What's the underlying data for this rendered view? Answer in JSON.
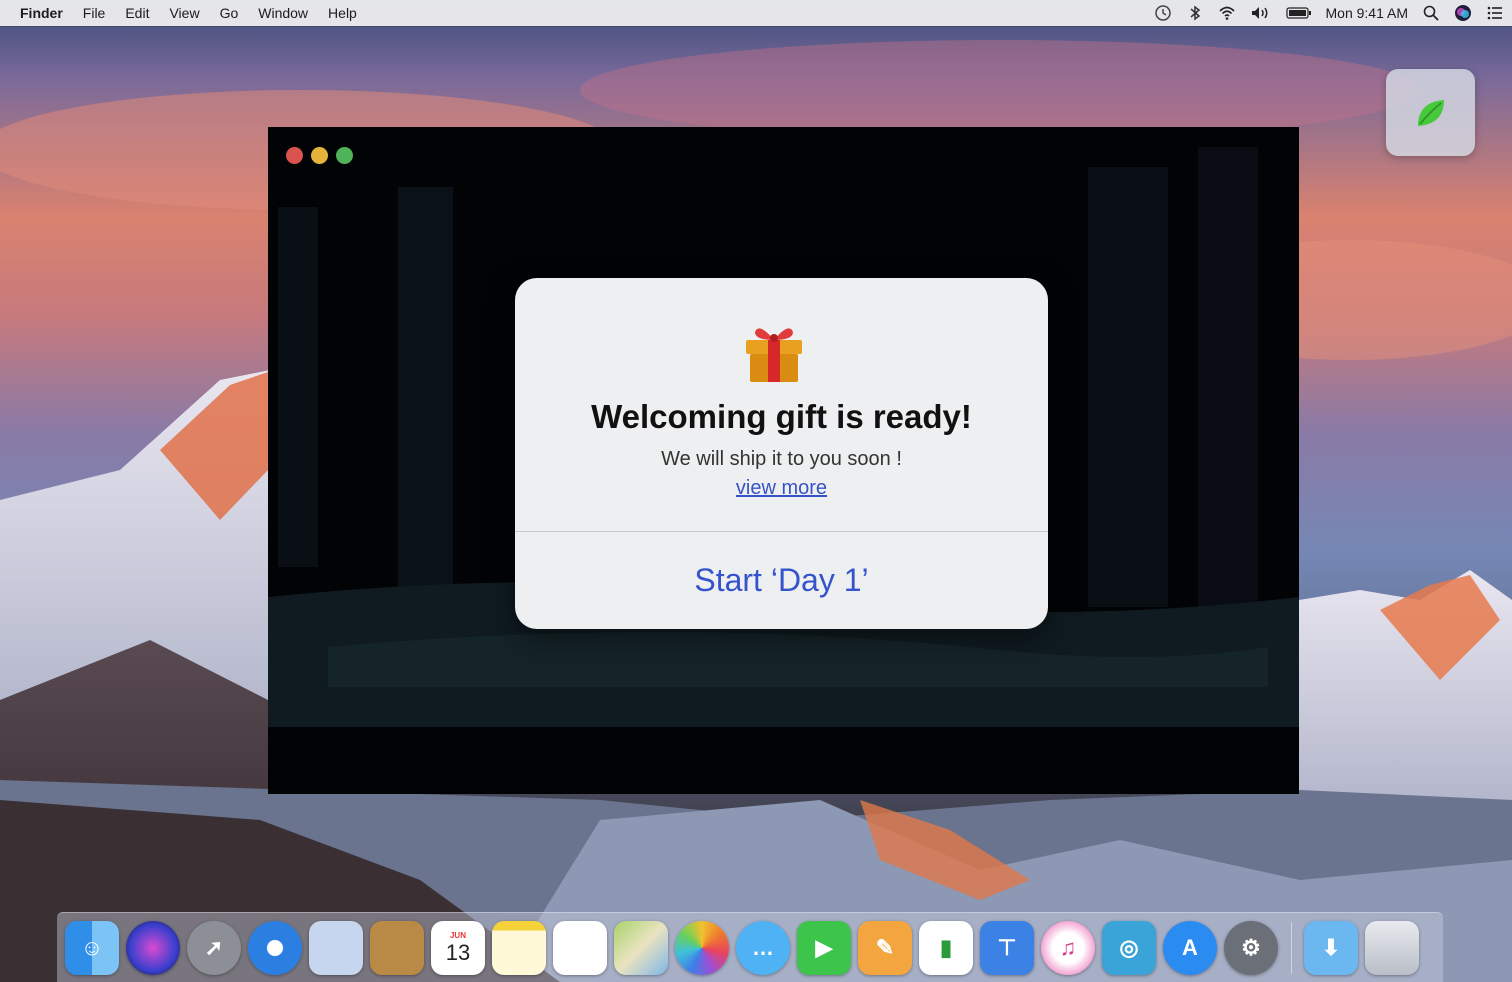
{
  "menubar": {
    "app_name": "Finder",
    "menus": [
      "File",
      "Edit",
      "View",
      "Go",
      "Window",
      "Help"
    ],
    "clock": "Mon 9:41 AM",
    "status_icons": [
      "time-machine-icon",
      "bluetooth-icon",
      "wifi-icon",
      "volume-icon",
      "battery-icon",
      "spotlight-icon",
      "siri-icon",
      "notification-center-icon"
    ]
  },
  "dialog": {
    "icon": "gift-icon",
    "title": "Welcoming gift is ready!",
    "subtitle": "We will ship it to you soon !",
    "link_label": "view more",
    "button_label": "Start ‘Day 1’"
  },
  "dock": {
    "items": [
      {
        "name": "finder",
        "icon": "finder-icon"
      },
      {
        "name": "siri",
        "icon": "siri-icon"
      },
      {
        "name": "launchpad",
        "icon": "rocket-icon"
      },
      {
        "name": "safari",
        "icon": "compass-icon"
      },
      {
        "name": "mail",
        "icon": "eagle-stamp-icon"
      },
      {
        "name": "contacts",
        "icon": "contacts-book-icon"
      },
      {
        "name": "calendar",
        "icon": "calendar-icon",
        "month": "JUN",
        "day": "13"
      },
      {
        "name": "notes",
        "icon": "notes-icon"
      },
      {
        "name": "reminders",
        "icon": "reminders-icon"
      },
      {
        "name": "maps",
        "icon": "map-icon"
      },
      {
        "name": "photos",
        "icon": "photos-flower-icon"
      },
      {
        "name": "messages",
        "icon": "speech-bubble-icon"
      },
      {
        "name": "facetime",
        "icon": "video-camera-icon"
      },
      {
        "name": "pages",
        "icon": "pages-pen-icon"
      },
      {
        "name": "numbers",
        "icon": "bar-chart-icon"
      },
      {
        "name": "keynote",
        "icon": "podium-icon"
      },
      {
        "name": "music",
        "icon": "music-note-icon"
      },
      {
        "name": "custom-app",
        "icon": "spiral-icon"
      },
      {
        "name": "app-store",
        "icon": "app-store-a-icon"
      },
      {
        "name": "system-preferences",
        "icon": "gear-icon"
      },
      {
        "name": "downloads",
        "icon": "downloads-folder-icon"
      },
      {
        "name": "trash",
        "icon": "trash-icon"
      }
    ]
  },
  "colors": {
    "link": "#3753c6",
    "button_text": "#3553cc",
    "dialog_bg": "#eeeff0",
    "window_bg": "#020305"
  }
}
